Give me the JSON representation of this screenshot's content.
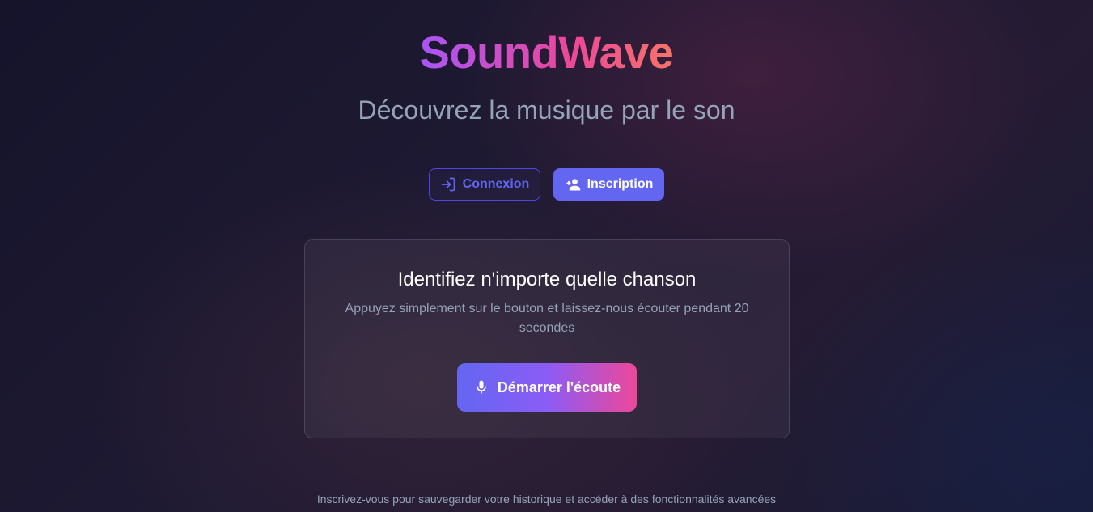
{
  "brand": {
    "title": "SoundWave",
    "tagline": "Découvrez la musique par le son"
  },
  "auth": {
    "login_label": "Connexion",
    "login_icon": "login-icon",
    "signup_label": "Inscription",
    "signup_icon": "person-add-icon"
  },
  "card": {
    "title": "Identifiez n'importe quelle chanson",
    "description": "Appuyez simplement sur le bouton et laissez-nous écouter pendant 20 secondes",
    "listen_label": "Démarrer l'écoute",
    "listen_icon": "microphone-icon"
  },
  "footer": {
    "note": "Inscrivez-vous pour sauvegarder votre historique et accéder à des fonctionnalités avancées"
  },
  "colors": {
    "accent": "#6366f1",
    "pink": "#ec4899",
    "muted_text": "#94a3b8"
  }
}
